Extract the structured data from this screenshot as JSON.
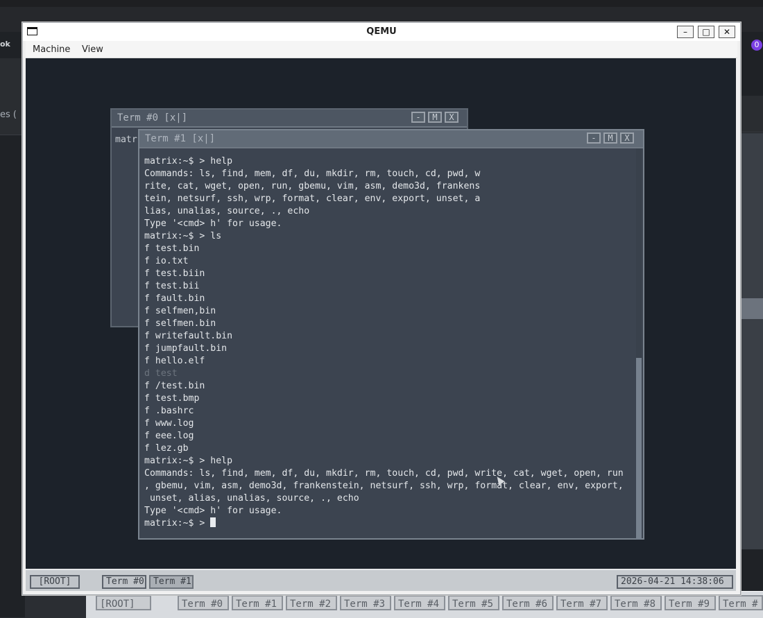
{
  "host": {
    "left_text": "es (",
    "left_small": "ok",
    "right_badge": "0",
    "bg_taskbar": [
      "[ROOT]",
      "Term #0",
      "Term #1",
      "Term #2",
      "Term #3",
      "Term #4",
      "Term #5",
      "Term #6",
      "Term #7",
      "Term #8",
      "Term #9",
      "Term #"
    ]
  },
  "qemu": {
    "title": "QEMU",
    "menu": [
      "Machine",
      "View"
    ],
    "window_controls": {
      "minimize": "–",
      "maximize": "□",
      "close": "✕"
    }
  },
  "guest": {
    "term0": {
      "title": "Term #0 [x|]",
      "visible_text": "matr",
      "controls": [
        "-",
        "M",
        "X"
      ]
    },
    "term1": {
      "title": "Term #1 [x|]",
      "controls": [
        "-",
        "M",
        "X"
      ],
      "lines": [
        "matrix:~$ > help",
        "Commands: ls, find, mem, df, du, mkdir, rm, touch, cd, pwd, w",
        "rite, cat, wget, open, run, gbemu, vim, asm, demo3d, frankens",
        "tein, netsurf, ssh, wrp, format, clear, env, export, unset, a",
        "lias, unalias, source, ., echo",
        "Type '<cmd> h' for usage.",
        "matrix:~$ > ls",
        "f test.bin",
        "f io.txt",
        "f test.biin",
        "f test.bii",
        "f fault.bin",
        "f selfmen,bin",
        "f selfmen.bin",
        "f writefault.bin",
        "f jumpfault.bin",
        "f hello.elf",
        "d test",
        "f /test.bin",
        "f test.bmp",
        "f .bashrc",
        "f www.log",
        "f eee.log",
        "f lez.gb",
        "matrix:~$ > help",
        "Commands: ls, find, mem, df, du, mkdir, rm, touch, cd, pwd, write, cat, wget, open, run",
        ", gbemu, vim, asm, demo3d, frankenstein, netsurf, ssh, wrp, format, clear, env, export,",
        " unset, alias, unalias, source, ., echo",
        "Type '<cmd> h' for usage.",
        "matrix:~$ > "
      ],
      "dim_line_index": 17
    },
    "taskbar": {
      "root": "[ROOT]",
      "tasks": [
        "Term #0",
        "Term #1"
      ],
      "clock": "2026-04-21 14:38:06"
    }
  }
}
